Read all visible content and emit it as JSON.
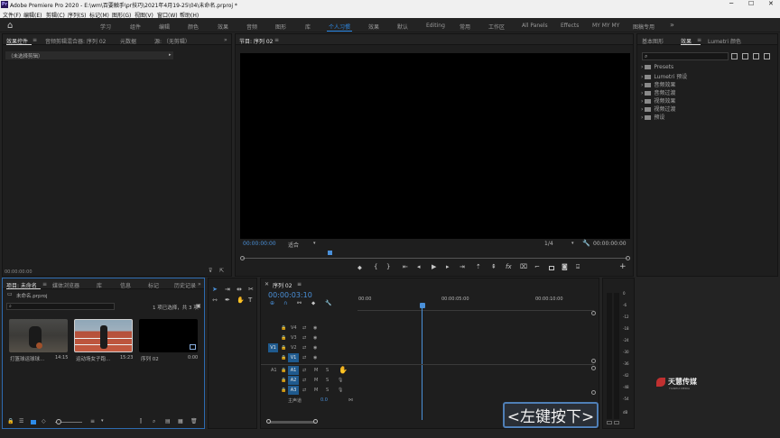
{
  "titlebar": {
    "text": "Adobe Premiere Pro 2020 - E:\\wm\\百要触手\\pr技巧\\2021年4月19-25\\04\\未命名.prproj *"
  },
  "menu": [
    "文件(F)",
    "编辑(E)",
    "剪辑(C)",
    "序列(S)",
    "标记(M)",
    "图形(G)",
    "视图(V)",
    "窗口(W)",
    "帮助(H)"
  ],
  "workspaces": [
    "学习",
    "组件",
    "编辑",
    "颜色",
    "效果",
    "音频",
    "图形",
    "库",
    "个人习惯",
    "效果",
    "默认",
    "Editing",
    "常用",
    "工作区",
    "All Panels",
    "Effects",
    "MY MY MY",
    "图稿专用"
  ],
  "active_workspace": "个人习惯",
  "effect_controls": {
    "tabs": [
      "效果控件",
      "音频剪辑混合器: 序列 02",
      "元数据",
      "源: （无剪辑）"
    ],
    "no_clip": "（未选择剪辑）",
    "timecode": "00:00:00:00"
  },
  "program": {
    "title": "节目: 序列 02",
    "timecode_left": "00:00:00:00",
    "fit": "适合",
    "quality": "1/4",
    "timecode_right": "00:00:00:00"
  },
  "project": {
    "tabs": [
      "项目: 未命名",
      "媒体浏览器",
      "库",
      "信息",
      "标记",
      "历史记录"
    ],
    "file": "未命名.prproj",
    "selection": "1 项已选择，共 3 项",
    "items": [
      {
        "name": "打篮球运球球...",
        "duration": "14:15"
      },
      {
        "name": "运动场女子跑...",
        "duration": "15:23"
      },
      {
        "name": "序列 02",
        "duration": "0:00"
      }
    ]
  },
  "timeline": {
    "title": "序列 02",
    "timecode": "00:00:03:10",
    "ruler": [
      "00:00",
      "00:00:05:00",
      "00:00:10:00"
    ],
    "video_tracks": [
      "V4",
      "V3",
      "V2",
      "V1"
    ],
    "audio_tracks": [
      "A1",
      "A2",
      "A3"
    ],
    "source_v": "V1",
    "source_a": "A1",
    "master": "主声道",
    "master_value": "0.0"
  },
  "effects": {
    "tabs": [
      "基本图形",
      "效果",
      "Lumetri 颜色"
    ],
    "folders": [
      "Presets",
      "Lumetri 预设",
      "音频效果",
      "音频过渡",
      "视频效果",
      "视频过渡",
      "预设"
    ]
  },
  "audio_meter": {
    "labels": [
      "0",
      "-6",
      "-12",
      "-18",
      "-24",
      "-30",
      "-36",
      "-42",
      "-48",
      "-54",
      "dB"
    ]
  },
  "overlay": {
    "key_hint": "<左键按下>"
  },
  "watermark": {
    "name": "天慧传媒",
    "sub": "TIANHUI MEDIA"
  },
  "colors": {
    "accent": "#2d8ceb",
    "playhead": "#4a90d9",
    "track_blue": "#1f5a8e"
  }
}
